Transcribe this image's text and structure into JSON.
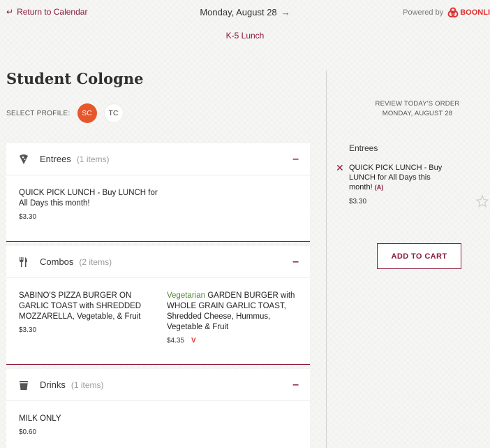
{
  "topbar": {
    "back_label": "Return to Calendar",
    "date": "Monday, August 28",
    "meal": "K-5 Lunch",
    "powered_by": "Powered by",
    "brand": "BOONLI"
  },
  "student": {
    "name": "Student Cologne",
    "select_profile_label": "SELECT PROFILE:",
    "profiles": [
      {
        "initials": "SC",
        "active": true
      },
      {
        "initials": "TC",
        "active": false
      }
    ]
  },
  "sections": [
    {
      "title": "Entrees",
      "count": "(1 items)",
      "icon": "pizza-slice-icon",
      "items": [
        {
          "name": "QUICK PICK LUNCH - Buy LUNCH for All Days this month!",
          "price": "$3.30"
        }
      ]
    },
    {
      "title": "Combos",
      "count": "(2 items)",
      "icon": "fork-knife-icon",
      "items": [
        {
          "name": "SABINO'S PIZZA BURGER ON GARLIC TOAST with SHREDDED MOZZARELLA, Vegetable, & Fruit",
          "price": "$3.30"
        },
        {
          "prefix": "Vegetarian",
          "name": "GARDEN BURGER with WHOLE GRAIN GARLIC TOAST, Shredded Cheese, Hummus, Vegetable & Fruit",
          "price": "$4.35",
          "tag": "V"
        }
      ]
    },
    {
      "title": "Drinks",
      "count": "(1 items)",
      "icon": "cup-icon",
      "items": [
        {
          "name": "MILK ONLY",
          "price": "$0.60"
        }
      ]
    }
  ],
  "order": {
    "review_line1": "REVIEW TODAY'S ORDER",
    "review_line2": "MONDAY, AUGUST 28",
    "group": "Entrees",
    "item_name": "QUICK PICK LUNCH - Buy LUNCH for All Days this month!",
    "item_tag": "(A)",
    "item_price": "$3.30",
    "add_to_cart": "ADD TO CART"
  },
  "colors": {
    "accent": "#8b1a3d",
    "profile_active": "#e8562a",
    "veg_green": "#4f8a2f",
    "brand_red": "#e03131"
  }
}
